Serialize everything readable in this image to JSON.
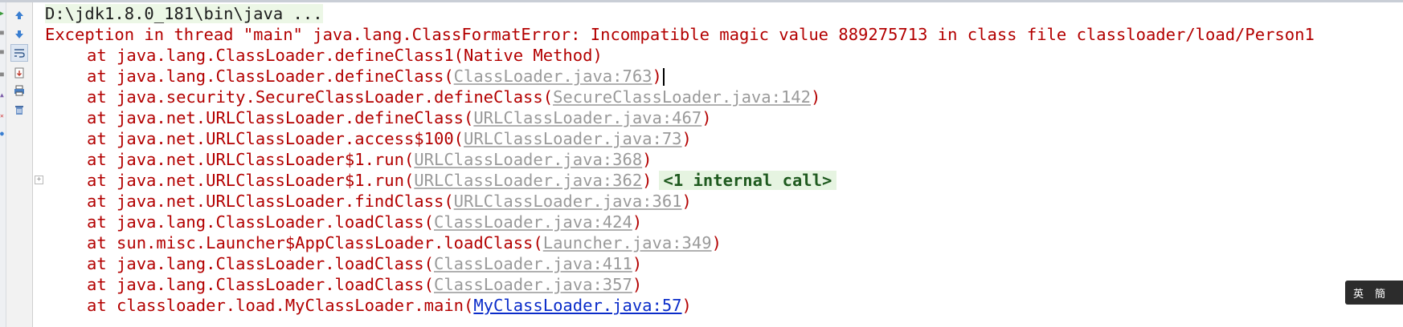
{
  "console": {
    "command": "D:\\jdk1.8.0_181\\bin\\java ...",
    "exception": "Exception in thread \"main\" java.lang.ClassFormatError: Incompatible magic value 889275713 in class file classloader/load/Person1",
    "frames": [
      {
        "prefix": "at java.lang.ClassLoader.defineClass1(",
        "link": "",
        "suffix": "Native Method)"
      },
      {
        "prefix": "at java.lang.ClassLoader.defineClass(",
        "link": "ClassLoader.java:763",
        "suffix": ")"
      },
      {
        "prefix": "at java.security.SecureClassLoader.defineClass(",
        "link": "SecureClassLoader.java:142",
        "suffix": ")"
      },
      {
        "prefix": "at java.net.URLClassLoader.defineClass(",
        "link": "URLClassLoader.java:467",
        "suffix": ")"
      },
      {
        "prefix": "at java.net.URLClassLoader.access$100(",
        "link": "URLClassLoader.java:73",
        "suffix": ")"
      },
      {
        "prefix": "at java.net.URLClassLoader$1.run(",
        "link": "URLClassLoader.java:368",
        "suffix": ")"
      },
      {
        "prefix": "at java.net.URLClassLoader$1.run(",
        "link": "URLClassLoader.java:362",
        "suffix": ")",
        "fold": "<1 internal call>"
      },
      {
        "prefix": "at java.net.URLClassLoader.findClass(",
        "link": "URLClassLoader.java:361",
        "suffix": ")"
      },
      {
        "prefix": "at java.lang.ClassLoader.loadClass(",
        "link": "ClassLoader.java:424",
        "suffix": ")"
      },
      {
        "prefix": "at sun.misc.Launcher$AppClassLoader.loadClass(",
        "link": "Launcher.java:349",
        "suffix": ")"
      },
      {
        "prefix": "at java.lang.ClassLoader.loadClass(",
        "link": "ClassLoader.java:411",
        "suffix": ")"
      },
      {
        "prefix": "at java.lang.ClassLoader.loadClass(",
        "link": "ClassLoader.java:357",
        "suffix": ")"
      },
      {
        "prefix": "at classloader.load.MyClassLoader.main(",
        "link": "MyClassLoader.java:57",
        "suffix": ")",
        "user_code": true
      }
    ]
  },
  "toolbar": {
    "icons": [
      "up-arrow-icon",
      "down-arrow-icon",
      "soft-wrap-icon",
      "scroll-to-end-icon",
      "print-icon",
      "trash-icon"
    ]
  },
  "ime": {
    "mode": "英",
    "charset": "簡"
  },
  "colors": {
    "error": "#b30000",
    "link": "#9a9a9a",
    "user_link": "#0a2cc9",
    "fold_bg": "#e6f4e1"
  }
}
